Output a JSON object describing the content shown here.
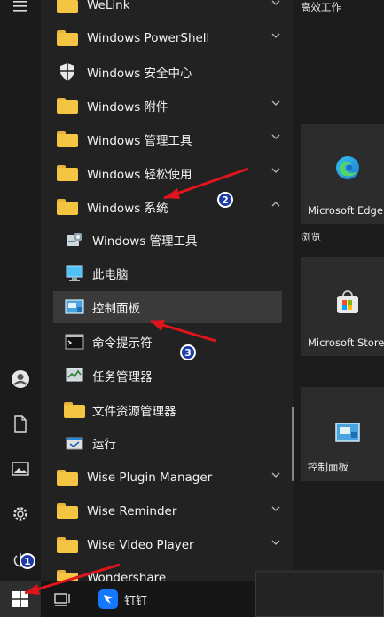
{
  "app_list": {
    "items": [
      {
        "label": "WeLink",
        "type": "folder",
        "expandable": true
      },
      {
        "label": "Windows PowerShell",
        "type": "folder",
        "expandable": true
      },
      {
        "label": "Windows 安全中心",
        "type": "shield",
        "expandable": false
      },
      {
        "label": "Windows 附件",
        "type": "folder",
        "expandable": true
      },
      {
        "label": "Windows 管理工具",
        "type": "folder",
        "expandable": true
      },
      {
        "label": "Windows 轻松使用",
        "type": "folder",
        "expandable": true
      },
      {
        "label": "Windows 系统",
        "type": "folder",
        "expandable": true,
        "expanded": true
      },
      {
        "label": "Windows 管理工具",
        "type": "admin-tools",
        "sub": true
      },
      {
        "label": "此电脑",
        "type": "computer",
        "sub": true
      },
      {
        "label": "控制面板",
        "type": "control-panel",
        "sub": true,
        "highlighted": true
      },
      {
        "label": "命令提示符",
        "type": "cmd",
        "sub": true
      },
      {
        "label": "任务管理器",
        "type": "task-manager",
        "sub": true
      },
      {
        "label": "文件资源管理器",
        "type": "folder",
        "sub": true
      },
      {
        "label": "运行",
        "type": "run",
        "sub": true
      },
      {
        "label": "Wise Plugin Manager",
        "type": "folder",
        "expandable": true
      },
      {
        "label": "Wise Reminder",
        "type": "folder",
        "expandable": true
      },
      {
        "label": "Wise Video Player",
        "type": "folder",
        "expandable": true
      },
      {
        "label": "Wondershare",
        "type": "folder",
        "expandable": true
      }
    ]
  },
  "tiles": {
    "group_high_efficiency": "高效工作",
    "group_browse": "浏览",
    "edge": "Microsoft Edge",
    "store": "Microsoft Store",
    "control_panel": "控制面板"
  },
  "taskbar": {
    "pinned_app": "钉钉"
  },
  "annotations": {
    "badge1": "1",
    "badge2": "2",
    "badge3": "3",
    "arrow_color": "#e0141c"
  },
  "colors": {
    "folder": "#f4c542",
    "badge": "#1d3aa8"
  }
}
